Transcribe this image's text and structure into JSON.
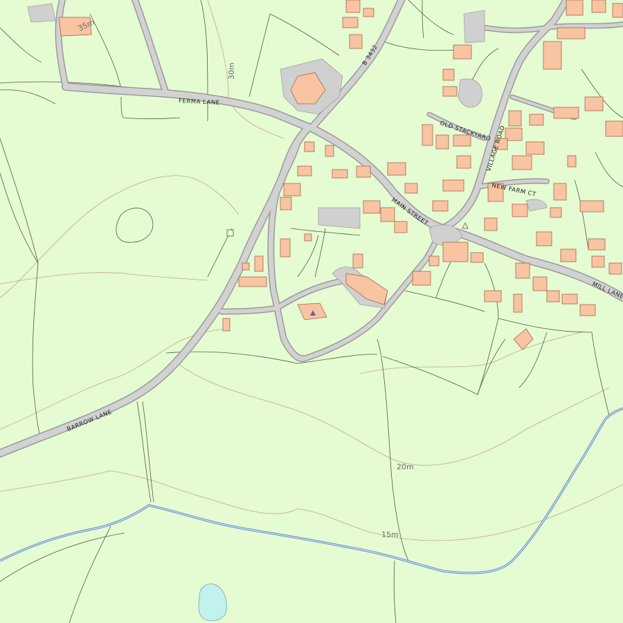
{
  "map": {
    "background_color": "#e5fbd2",
    "building_color": "#f8c4a2",
    "road_color": "#d2d2d2",
    "water_color": "#c2f2ee",
    "river_color": "#5b7fbf",
    "contour_color": "#c4a87a"
  },
  "roads": {
    "ferma_lane": "FERMA LANE",
    "barrow_lane": "BARROW LANE",
    "b3432": "B 3432",
    "main_street": "MAIN STREET",
    "old_stackyard": "OLD STACKYARD",
    "village_road": "VILLAGE ROAD",
    "new_farm_ct": "NEW FARM CT",
    "mill_lane": "MILL LANE"
  },
  "contours": {
    "c35": "35m",
    "c30": "30m",
    "c20": "20m",
    "c15": "15m"
  }
}
